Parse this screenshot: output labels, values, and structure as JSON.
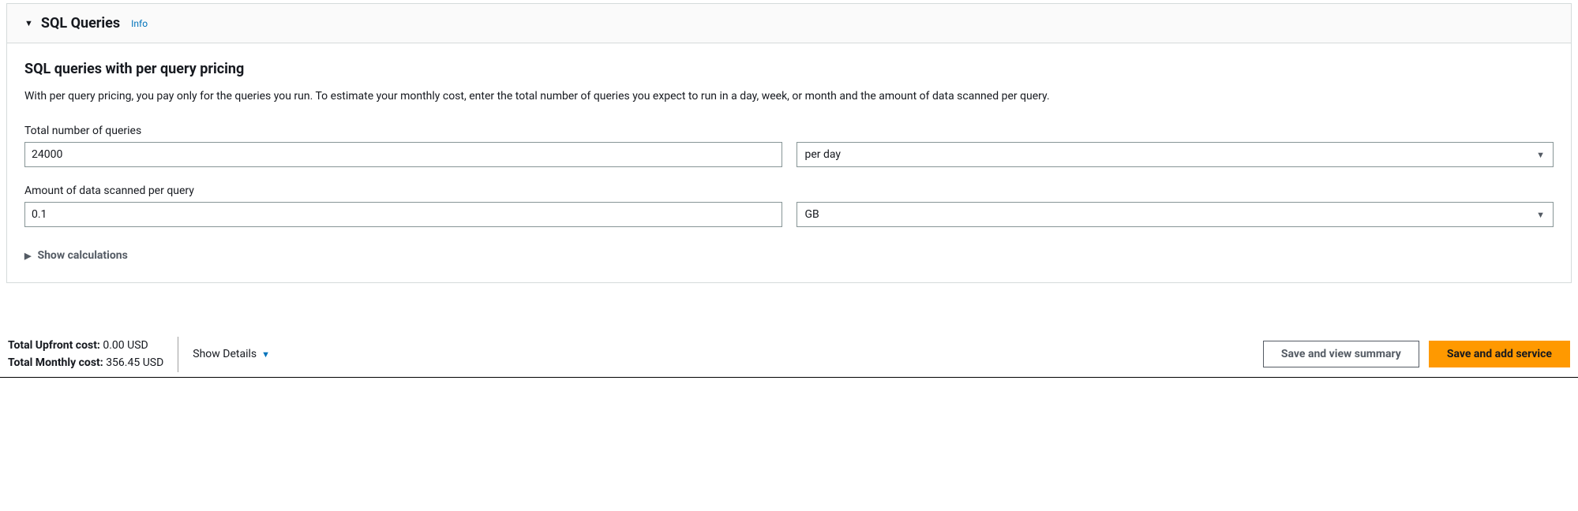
{
  "panel": {
    "title": "SQL Queries",
    "info_label": "Info"
  },
  "section": {
    "title": "SQL queries with per query pricing",
    "description": "With per query pricing, you pay only for the queries you run. To estimate your monthly cost, enter the total number of queries you expect to run in a day, week, or month and the amount of data scanned per query."
  },
  "fields": {
    "queries": {
      "label": "Total number of queries",
      "value": "24000",
      "unit_selected": "per day"
    },
    "data_scanned": {
      "label": "Amount of data scanned per query",
      "value": "0.1",
      "unit_selected": "GB"
    }
  },
  "show_calculations_label": "Show calculations",
  "totals": {
    "upfront_label": "Total Upfront cost:",
    "upfront_value": "0.00 USD",
    "monthly_label": "Total Monthly cost:",
    "monthly_value": "356.45 USD"
  },
  "show_details_label": "Show Details",
  "buttons": {
    "save_summary": "Save and view summary",
    "save_add": "Save and add service"
  }
}
